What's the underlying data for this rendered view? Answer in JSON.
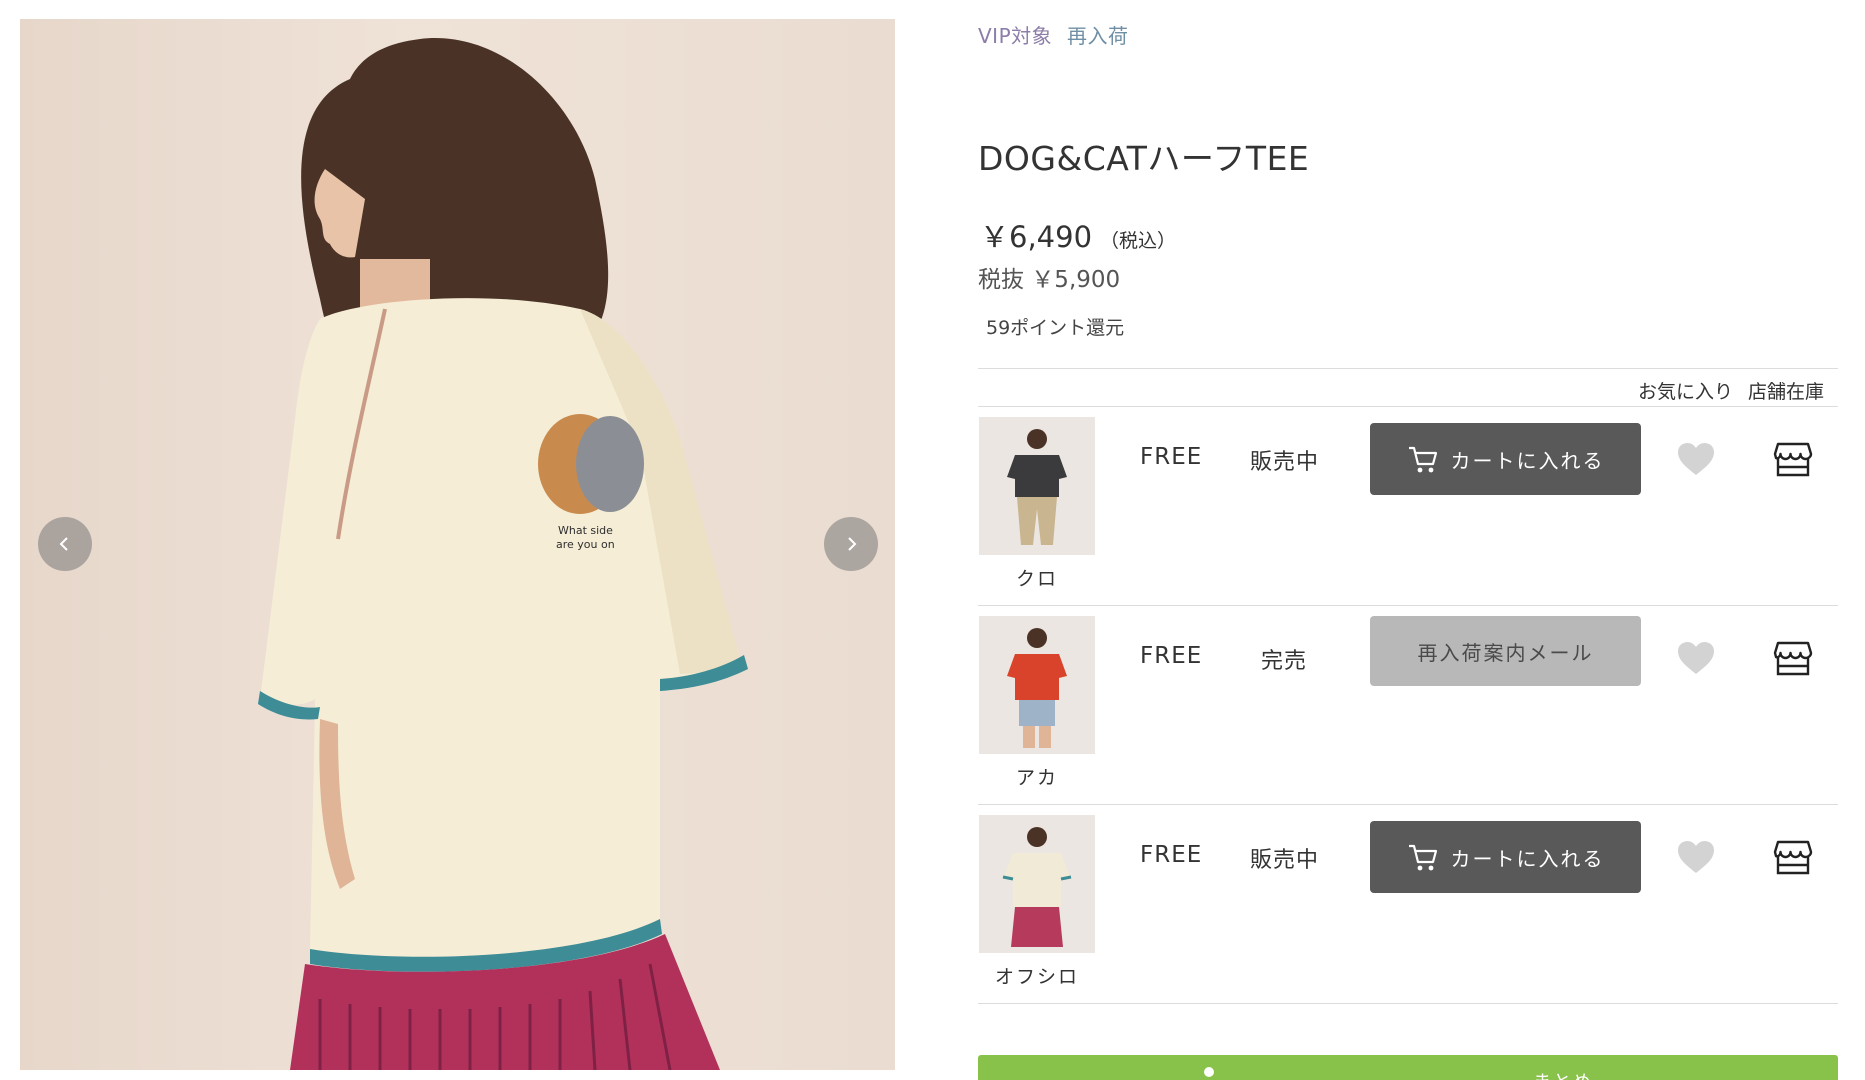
{
  "gallery": {
    "prev_icon": "chevron-left-icon",
    "next_icon": "chevron-right-icon",
    "shirt_print_text": [
      "What side",
      "are you on"
    ]
  },
  "product": {
    "tags": [
      "VIP対象",
      "再入荷"
    ],
    "title": "DOG&CATハーフTEE",
    "price": "￥6,490",
    "price_tax_note": "（税込）",
    "price_ex_tax": "税抜 ￥5,900",
    "points": "59ポイント還元"
  },
  "table_headers": {
    "favorite": "お気に入り",
    "store_stock": "店舗在庫"
  },
  "variants": [
    {
      "color": "クロ",
      "size": "FREE",
      "status": "販売中",
      "button": "カートに入れる",
      "button_type": "cart",
      "shirt_color": "#3b3b3d",
      "bottom_color": "#c9b58f"
    },
    {
      "color": "アカ",
      "size": "FREE",
      "status": "完売",
      "button": "再入荷案内メール",
      "button_type": "mail",
      "shirt_color": "#d9432b",
      "bottom_color": "#9fb3c8"
    },
    {
      "color": "オフシロ",
      "size": "FREE",
      "status": "販売中",
      "button": "カートに入れる",
      "button_type": "cart",
      "shirt_color": "#f1ead7",
      "bottom_color": "#b53a5c"
    }
  ],
  "colors": {
    "cart_button": "#595959",
    "mail_button": "#b8b8b8",
    "tag_vip": "#8c7ea8",
    "tag_restock": "#6f8fa6",
    "green_bar": "#88c24a"
  },
  "bottom_bar": {
    "partial_text": "まとめ"
  }
}
